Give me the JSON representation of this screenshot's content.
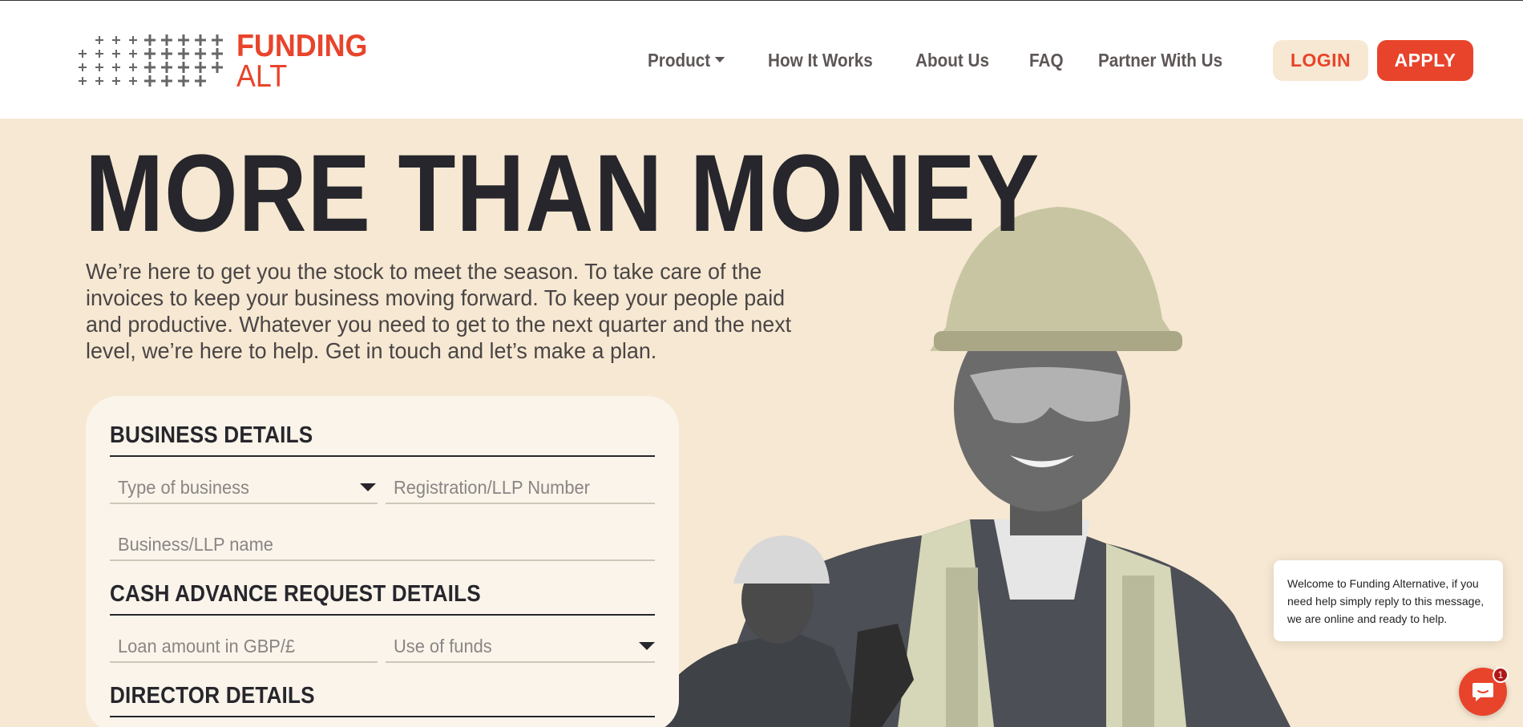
{
  "brand": {
    "name_line1": "FUNDING",
    "name_line2": "ALT",
    "accent": "#e8442b",
    "dark": "#26262c",
    "cream": "#f6e8d2"
  },
  "nav": {
    "items": [
      {
        "label": "Product",
        "has_dropdown": true
      },
      {
        "label": "How It Works"
      },
      {
        "label": "About Us"
      },
      {
        "label": "FAQ"
      },
      {
        "label": "Partner With Us"
      }
    ],
    "login_label": "LOGIN",
    "apply_label": "APPLY"
  },
  "hero": {
    "title": "MORE THAN MONEY",
    "body": "We’re here to get you the stock to meet the season. To take care of the invoices to keep your business moving forward. To keep your people paid and productive. Whatever you need to get to the next quarter and the next level, we’re here to help. Get in touch and let’s make a plan."
  },
  "form": {
    "business_heading": "BUSINESS DETAILS",
    "type_of_business_placeholder": "Type of business",
    "registration_placeholder": "Registration/LLP Number",
    "business_name_placeholder": "Business/LLP name",
    "cash_heading": "CASH ADVANCE REQUEST DETAILS",
    "loan_amount_placeholder": "Loan amount in GBP/£",
    "use_of_funds_placeholder": "Use of funds",
    "director_heading": "DIRECTOR DETAILS"
  },
  "chat": {
    "message": "Welcome to Funding Alternative, if you need help simply reply to this message, we are online and ready to help.",
    "unread_count": "1",
    "launcher_icon": "chat-icon"
  }
}
